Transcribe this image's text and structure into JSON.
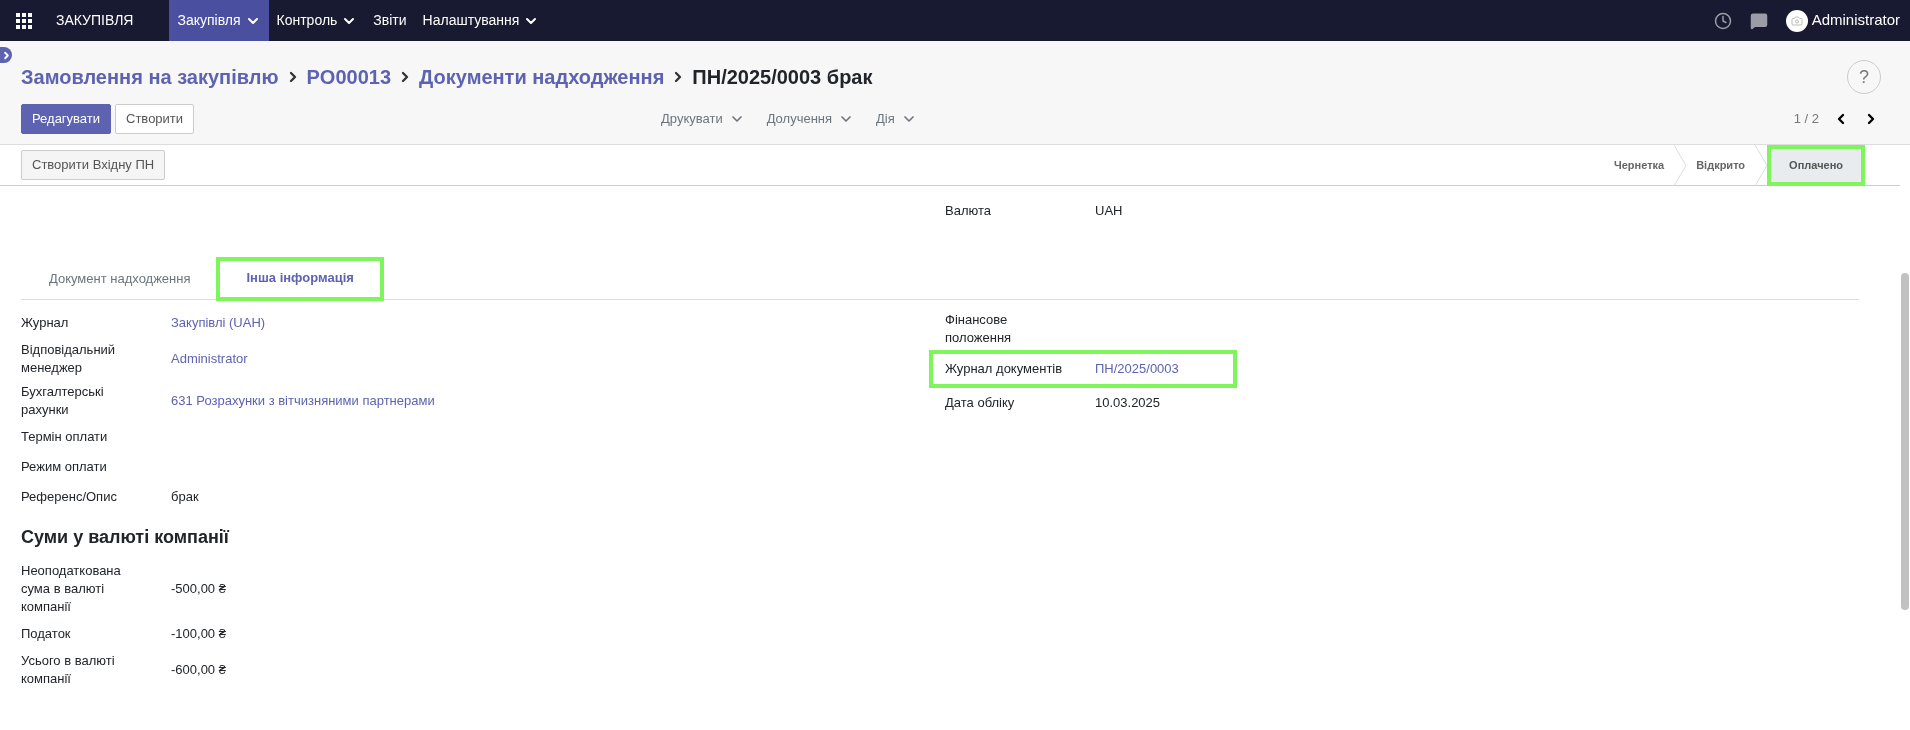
{
  "topbar": {
    "app_name": "ЗАКУПІВЛЯ",
    "menus": [
      {
        "label": "Закупівля",
        "selected": true,
        "dropdown": true
      },
      {
        "label": "Контроль",
        "selected": false,
        "dropdown": true
      },
      {
        "label": "Звіти",
        "selected": false,
        "dropdown": false
      },
      {
        "label": "Налаштування",
        "selected": false,
        "dropdown": true
      }
    ],
    "user": "Administrator"
  },
  "breadcrumbs": [
    {
      "label": "Замовлення на закупівлю",
      "current": false
    },
    {
      "label": "PO00013",
      "current": false
    },
    {
      "label": "Документи надходження",
      "current": false
    },
    {
      "label": "ПН/2025/0003 брак",
      "current": true
    }
  ],
  "buttons": [
    {
      "label": "Редагувати",
      "kind": "primary"
    },
    {
      "label": "Створити",
      "kind": "secondary"
    }
  ],
  "actions": [
    {
      "label": "Друкувати"
    },
    {
      "label": "Долучення"
    },
    {
      "label": "Дія"
    }
  ],
  "pager": "1 / 2",
  "help": "?",
  "status_bar": {
    "button": "Створити Вхідну ПН",
    "stages": [
      {
        "label": "Чернетка",
        "selected": false,
        "highlighted": false
      },
      {
        "label": "Відкрито",
        "selected": false,
        "highlighted": false
      },
      {
        "label": "Оплачено",
        "selected": true,
        "highlighted": true
      }
    ]
  },
  "header_fields": [
    {
      "label": "Валюта",
      "value": "UAH",
      "kind": "text"
    }
  ],
  "tabs": [
    {
      "label": "Документ надходження",
      "selected": false,
      "highlighted": false
    },
    {
      "label": "Інша інформація",
      "selected": true,
      "highlighted": true
    }
  ],
  "left_fields": [
    {
      "label": "Журнал",
      "value": "Закупівлі (UAH)",
      "kind": "link"
    },
    {
      "label": "Відповідальний менеджер",
      "value": "Administrator",
      "kind": "link"
    },
    {
      "label": "Бухгалтерські рахунки",
      "value": "631 Розрахунки з вітчизняними партнерами",
      "kind": "link"
    },
    {
      "label": "Термін оплати",
      "kind": "text"
    },
    {
      "label": "Режим оплати",
      "kind": "text"
    },
    {
      "label": "Референс/Опис",
      "value": "брак",
      "kind": "text"
    }
  ],
  "section_title": "Суми у валюті компанії",
  "amount_fields": [
    {
      "label": "Неоподаткована сума в валюті компанії",
      "value": "-500,00 ₴",
      "kind": "text"
    },
    {
      "label": "Податок",
      "value": "-100,00 ₴",
      "kind": "text"
    },
    {
      "label": "Усього в валюті компанії",
      "value": "-600,00 ₴",
      "kind": "text"
    }
  ],
  "right_fields": [
    {
      "label": "Фінансове положення",
      "kind": "text",
      "highlighted": false
    },
    {
      "label": "Журнал документів",
      "value": "ПН/2025/0003",
      "kind": "link",
      "highlighted": true
    },
    {
      "label": "Дата обліку",
      "value": "10.03.2025",
      "kind": "text",
      "highlighted": false
    }
  ]
}
